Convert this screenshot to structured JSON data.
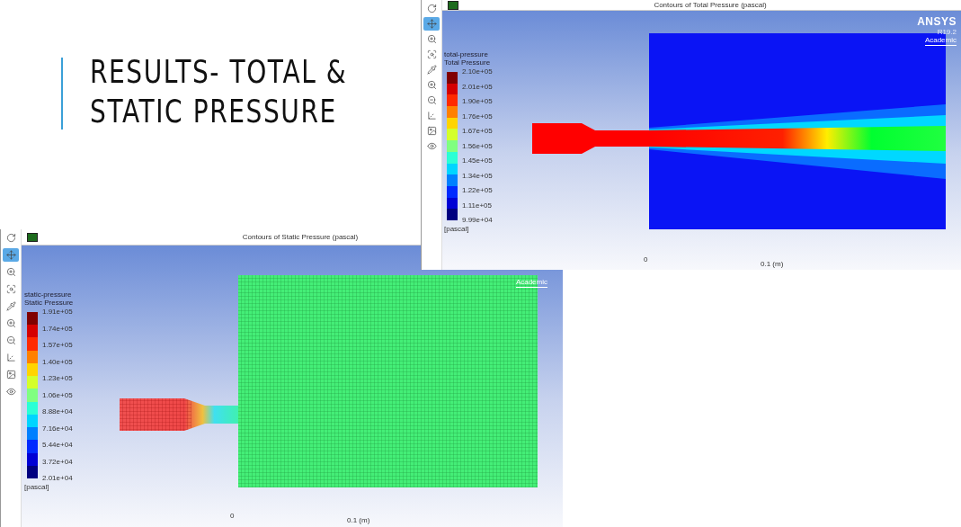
{
  "slide": {
    "title_lines": [
      "RESULTS- TOTAL &",
      "STATIC PRESSURE"
    ]
  },
  "windows": [
    {
      "kind": "total",
      "title": "Contours of Total Pressure (pascal)",
      "tools": [
        {
          "kind": "rotate",
          "selected": false
        },
        {
          "kind": "pan",
          "selected": true
        },
        {
          "kind": "zoom_in",
          "selected": false
        },
        {
          "kind": "zoom_box",
          "selected": false
        },
        {
          "kind": "probe",
          "selected": false
        },
        {
          "kind": "zoom_in",
          "selected": false
        },
        {
          "kind": "zoom_out",
          "selected": false
        },
        {
          "kind": "fit",
          "selected": false
        },
        {
          "kind": "snapshot",
          "selected": false
        },
        {
          "kind": "view_menu",
          "selected": false
        }
      ],
      "legend": {
        "variable": "total-pressure",
        "label": "Total Pressure",
        "values": [
          "2.10e+05",
          "2.01e+05",
          "1.90e+05",
          "1.76e+05",
          "1.67e+05",
          "1.56e+05",
          "1.45e+05",
          "1.34e+05",
          "1.22e+05",
          "1.11e+05",
          "9.99e+04"
        ],
        "unit": "[pascal]"
      },
      "logo": {
        "brand": "ANSYS",
        "version": "R19.2",
        "edition": "Academic"
      },
      "scale": {
        "start": "0",
        "end": "0.1 (m)"
      }
    },
    {
      "kind": "static",
      "title": "Contours of Static Pressure (pascal)",
      "tools": [
        {
          "kind": "rotate",
          "selected": false
        },
        {
          "kind": "pan",
          "selected": true
        },
        {
          "kind": "zoom_in",
          "selected": false
        },
        {
          "kind": "zoom_box",
          "selected": false
        },
        {
          "kind": "probe",
          "selected": false
        },
        {
          "kind": "zoom_in",
          "selected": false
        },
        {
          "kind": "zoom_out",
          "selected": false
        },
        {
          "kind": "fit",
          "selected": false
        },
        {
          "kind": "snapshot",
          "selected": false
        },
        {
          "kind": "view_menu",
          "selected": false
        }
      ],
      "legend": {
        "variable": "static-pressure",
        "label": "Static Pressure",
        "values": [
          "1.91e+05",
          "1.74e+05",
          "1.57e+05",
          "1.40e+05",
          "1.23e+05",
          "1.06e+05",
          "8.88e+04",
          "7.16e+04",
          "5.44e+04",
          "3.72e+04",
          "2.01e+04"
        ],
        "unit": "[pascal]"
      },
      "logo": {
        "edition": "Academic"
      },
      "scale": {
        "start": "0",
        "end": "0.1 (m)"
      }
    }
  ]
}
